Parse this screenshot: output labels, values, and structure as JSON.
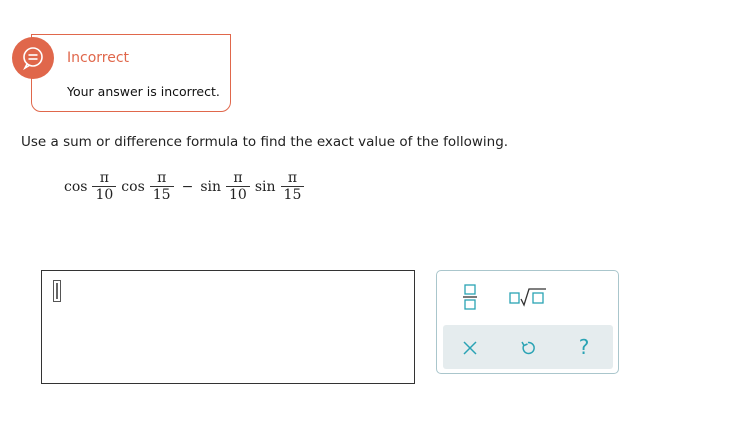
{
  "feedback": {
    "title": "Incorrect",
    "message": "Your answer is incorrect.",
    "accent_color": "#e0674b",
    "icon": "speech-bubble-icon"
  },
  "question": {
    "instructions": "Use a sum or difference formula to find the exact value of the following.",
    "expression": {
      "fn1": "cos",
      "num1": "π",
      "den1": "10",
      "fn2": "cos",
      "num2": "π",
      "den2": "15",
      "operator": "−",
      "fn3": "sin",
      "num3": "π",
      "den3": "10",
      "fn4": "sin",
      "num4": "π",
      "den4": "15"
    }
  },
  "answer": {
    "value": ""
  },
  "tools": {
    "fraction": "fraction-icon",
    "root": "nth-root-icon",
    "clear": "clear-icon",
    "undo": "undo-icon",
    "help_label": "?",
    "icon_color": "#2aa3b4"
  }
}
